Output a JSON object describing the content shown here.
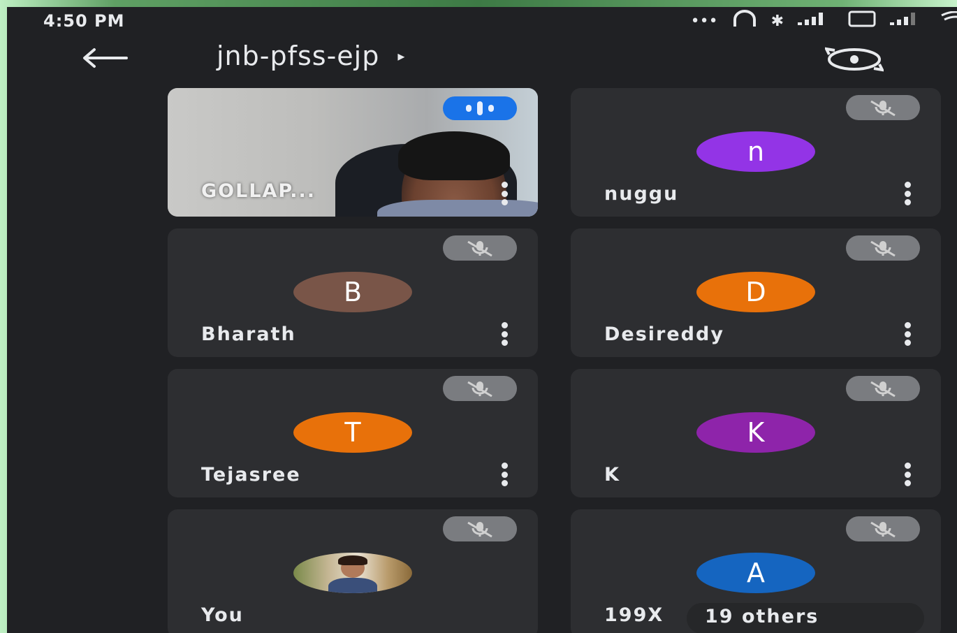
{
  "status_bar": {
    "time": "4:50 PM"
  },
  "header": {
    "meeting_code": "jnb-pfss-ejp",
    "caret": "▸"
  },
  "tiles": [
    {
      "name": "GOLLAP...",
      "type": "video",
      "speaking": true
    },
    {
      "name": "nuggu",
      "initial": "n",
      "avatar_color": "#9334e6",
      "muted": true
    },
    {
      "name": "Bharath",
      "initial": "B",
      "avatar_color": "#795548",
      "muted": true
    },
    {
      "name": "Desireddy",
      "initial": "D",
      "avatar_color": "#e8710a",
      "muted": true
    },
    {
      "name": "Tejasree",
      "initial": "T",
      "avatar_color": "#e8710a",
      "muted": true
    },
    {
      "name": "K",
      "initial": "K",
      "avatar_color": "#8e24aa",
      "muted": true
    },
    {
      "name": "You",
      "type": "photo",
      "muted": true
    },
    {
      "name": "199X",
      "initial": "A",
      "avatar_color": "#1565c0",
      "muted": true,
      "others_label": "19 others"
    }
  ]
}
